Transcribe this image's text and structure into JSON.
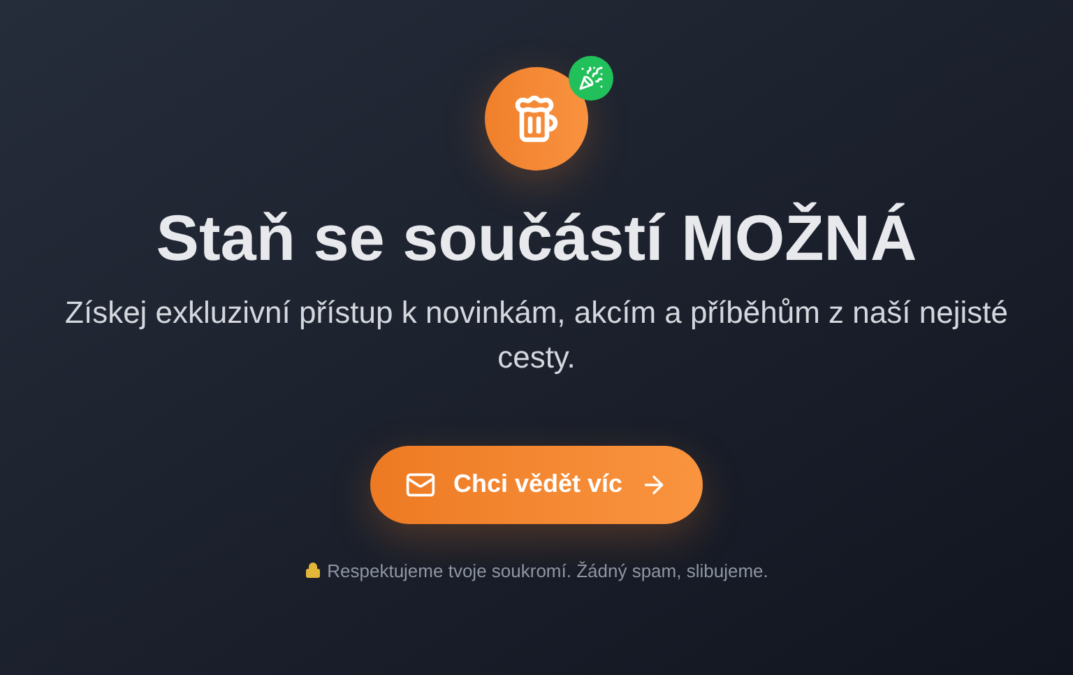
{
  "heading": "Staň se součástí MOŽNÁ",
  "subtitle": "Získej exkluzivní přístup k novinkám, akcím a příběhům z naší nejisté cesty.",
  "cta": {
    "label": "Chci vědět víc"
  },
  "privacy_note": "Respektujeme tvoje soukromí. Žádný spam, slibujeme."
}
